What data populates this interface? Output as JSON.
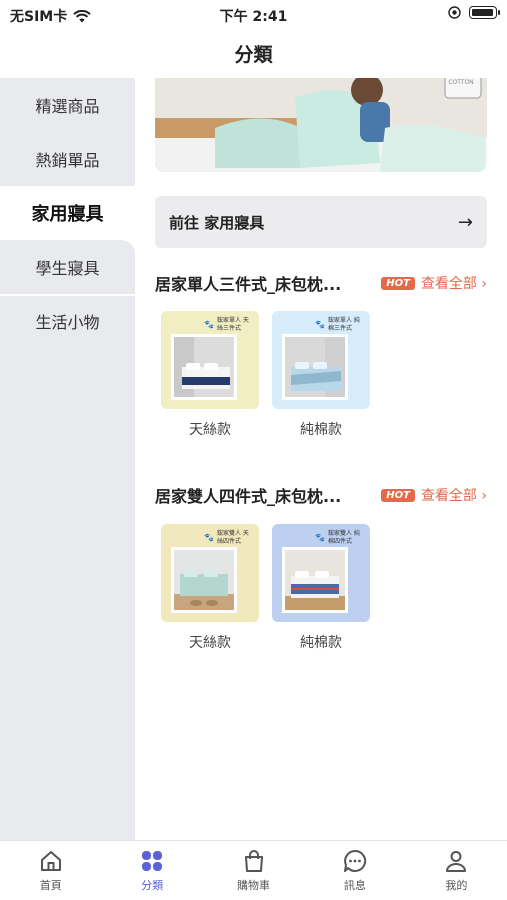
{
  "status_bar": {
    "carrier": "无SIM卡",
    "time": "下午 2:41"
  },
  "nav": {
    "title": "分類"
  },
  "sidebar": {
    "items": [
      {
        "label": "精選商品"
      },
      {
        "label": "熱銷單品"
      },
      {
        "label": "家用寢具"
      },
      {
        "label": "學生寢具"
      },
      {
        "label": "生活小物"
      }
    ],
    "active_index": 2
  },
  "banner": {
    "text": "COMBED COTTON"
  },
  "goto": {
    "label": "前往 家用寢具"
  },
  "sections": [
    {
      "title": "居家單人三件式_床包枕...",
      "hot": "HOT",
      "view_all": "查看全部 ›",
      "products": [
        {
          "label": "天絲款",
          "thumb_text": "鋐家單人 天絲三件式"
        },
        {
          "label": "純棉款",
          "thumb_text": "鋐家單人 純棉三件式"
        }
      ]
    },
    {
      "title": "居家雙人四件式_床包枕...",
      "hot": "HOT",
      "view_all": "查看全部 ›",
      "products": [
        {
          "label": "天絲款",
          "thumb_text": "鋐家雙人 天絲四件式"
        },
        {
          "label": "純棉款",
          "thumb_text": "鋐家雙人 純棉四件式"
        }
      ]
    }
  ],
  "tabbar": {
    "items": [
      {
        "label": "首頁",
        "icon": "home-icon"
      },
      {
        "label": "分類",
        "icon": "category-icon"
      },
      {
        "label": "購物車",
        "icon": "cart-icon"
      },
      {
        "label": "訊息",
        "icon": "message-icon"
      },
      {
        "label": "我的",
        "icon": "user-icon"
      }
    ],
    "active_index": 1
  },
  "colors": {
    "accent": "#5b62d9",
    "hot": "#e26a4b",
    "sidebar_bg": "#e9eaee"
  }
}
